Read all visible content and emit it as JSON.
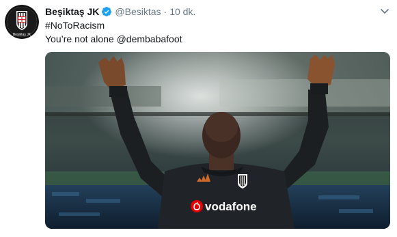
{
  "tweet": {
    "display_name": "Beşiktaş JK",
    "handle": "@Besiktas",
    "separator": "·",
    "time": "10 dk.",
    "text_hashtag": "#NoToRacism",
    "text_body": "You’re not alone ",
    "text_mention": "@dembabafoot",
    "avatar_caption": "Beşiktaş JK",
    "verified_color": "#1da1f2"
  },
  "media": {
    "jersey_sponsor": "vodafone",
    "sponsor_color": "#e60000"
  },
  "icons": {
    "verified": "verified-badge-icon",
    "more": "chevron-down-icon",
    "crest": "besiktas-crest-icon"
  }
}
